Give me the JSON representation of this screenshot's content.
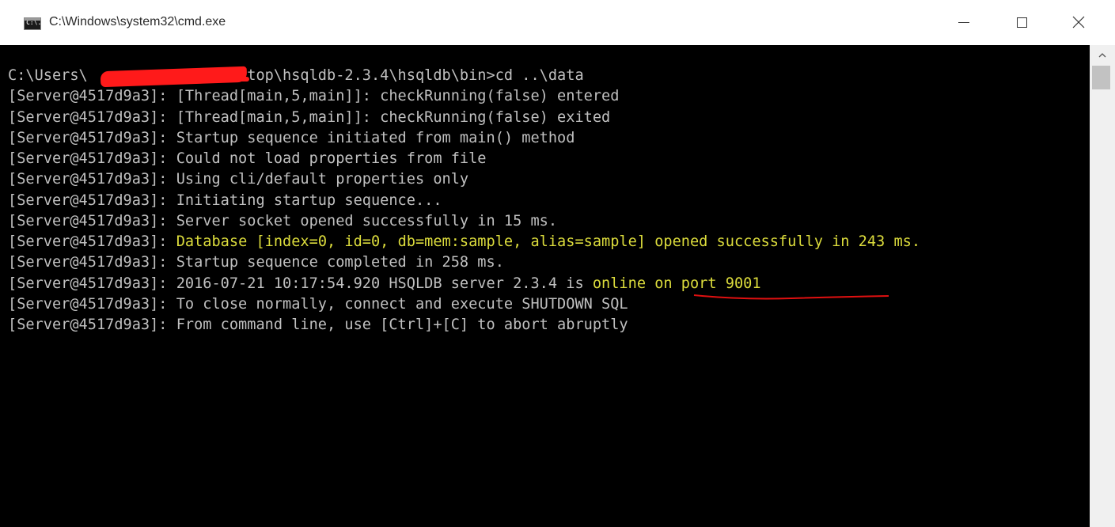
{
  "window": {
    "title": "C:\\Windows\\system32\\cmd.exe",
    "icon_label": "C:\\.",
    "controls": {
      "minimize": "minimize-icon",
      "maximize": "maximize-icon",
      "close": "close-icon",
      "close_glyph": "✕"
    }
  },
  "console": {
    "lines": [
      {
        "text": "C:\\Users\\             \\Desktop\\hsqldb-2.3.4\\hsqldb\\bin>cd ..\\data",
        "color": "#c0c0c0"
      },
      {
        "text": "[Server@4517d9a3]: [Thread[main,5,main]]: checkRunning(false) entered",
        "color": "#c0c0c0"
      },
      {
        "text": "[Server@4517d9a3]: [Thread[main,5,main]]: checkRunning(false) exited",
        "color": "#c0c0c0"
      },
      {
        "text": "[Server@4517d9a3]: Startup sequence initiated from main() method",
        "color": "#c0c0c0"
      },
      {
        "text": "[Server@4517d9a3]: Could not load properties from file",
        "color": "#c0c0c0"
      },
      {
        "text": "[Server@4517d9a3]: Using cli/default properties only",
        "color": "#c0c0c0"
      },
      {
        "text": "[Server@4517d9a3]: Initiating startup sequence...",
        "color": "#c0c0c0"
      },
      {
        "text": "[Server@4517d9a3]: Server socket opened successfully in 15 ms.",
        "color": "#c0c0c0"
      },
      {
        "prefix": "[Server@4517d9a3]: ",
        "highlight": "Database [index=0, id=0, db=mem:sample, alias=sample] opened successfully in 243 ms.",
        "color": "#dcdc3c"
      },
      {
        "text": "[Server@4517d9a3]: Startup sequence completed in 258 ms.",
        "color": "#c0c0c0"
      },
      {
        "prefix": "[Server@4517d9a3]: 2016-07-21 10:17:54.920 HSQLDB server 2.3.4 is ",
        "highlight": "online on port 9001",
        "color": "#dcdc3c"
      },
      {
        "text": "[Server@4517d9a3]: To close normally, connect and execute SHUTDOWN SQL",
        "color": "#c0c0c0"
      },
      {
        "text": "[Server@4517d9a3]: From command line, use [Ctrl]+[C] to abort abruptly",
        "color": "#c0c0c0"
      }
    ]
  },
  "scrollbar": {
    "up_arrow": "^"
  },
  "colors": {
    "console_bg": "#000000",
    "console_text": "#c0c0c0",
    "highlight_text": "#dcdc3c",
    "redaction": "#ff1a1a"
  }
}
